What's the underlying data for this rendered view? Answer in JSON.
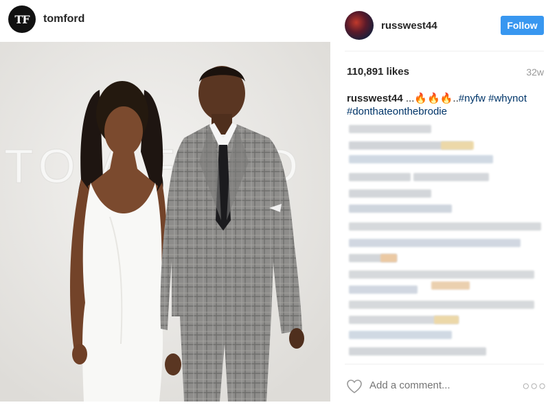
{
  "tagged_account": {
    "logo_text": "TF",
    "username": "tomford"
  },
  "photo": {
    "backdrop_text": "TOM FORD"
  },
  "owner": {
    "username": "russwest44",
    "follow_label": "Follow"
  },
  "stats": {
    "likes": "110,891 likes",
    "age": "32w"
  },
  "caption": {
    "username": "russwest44",
    "text_prefix": " ...",
    "emoji": "🔥🔥🔥",
    "text_mid": "..",
    "hashtag1": "#nyfw",
    "hashtag2": "#whynot",
    "hashtag3": "#donthateonthebrodie"
  },
  "comment_box": {
    "placeholder": "Add a comment...",
    "more_glyph": "○○○"
  },
  "colors": {
    "follow_blue": "#3897f0",
    "hashtag": "#003569",
    "muted": "#999999"
  }
}
